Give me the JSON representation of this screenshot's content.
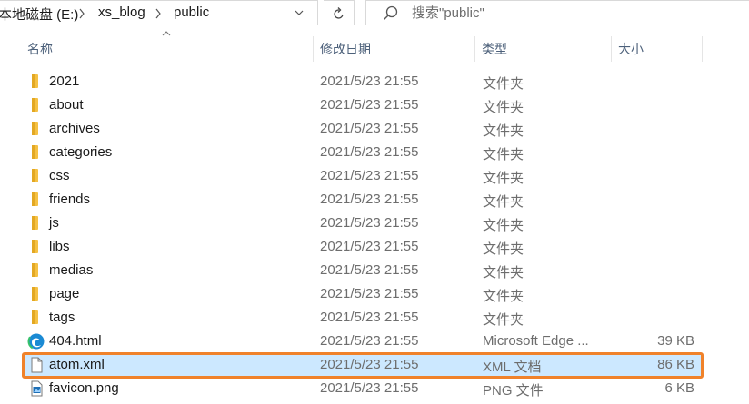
{
  "breadcrumb": {
    "drive": "本地磁盘 (E:)",
    "folder1": "xs_blog",
    "folder2": "public"
  },
  "search": {
    "placeholder": "搜索\"public\""
  },
  "columns": {
    "name": "名称",
    "date": "修改日期",
    "type": "类型",
    "size": "大小"
  },
  "files": [
    {
      "name": "2021",
      "date": "2021/5/23 21:55",
      "type": "文件夹",
      "size": "",
      "kind": "folder-icon"
    },
    {
      "name": "about",
      "date": "2021/5/23 21:55",
      "type": "文件夹",
      "size": "",
      "kind": "folder-icon"
    },
    {
      "name": "archives",
      "date": "2021/5/23 21:55",
      "type": "文件夹",
      "size": "",
      "kind": "folder-icon"
    },
    {
      "name": "categories",
      "date": "2021/5/23 21:55",
      "type": "文件夹",
      "size": "",
      "kind": "folder-icon"
    },
    {
      "name": "css",
      "date": "2021/5/23 21:55",
      "type": "文件夹",
      "size": "",
      "kind": "folder-icon"
    },
    {
      "name": "friends",
      "date": "2021/5/23 21:55",
      "type": "文件夹",
      "size": "",
      "kind": "folder-icon"
    },
    {
      "name": "js",
      "date": "2021/5/23 21:55",
      "type": "文件夹",
      "size": "",
      "kind": "folder-icon"
    },
    {
      "name": "libs",
      "date": "2021/5/23 21:55",
      "type": "文件夹",
      "size": "",
      "kind": "folder-icon"
    },
    {
      "name": "medias",
      "date": "2021/5/23 21:55",
      "type": "文件夹",
      "size": "",
      "kind": "folder-icon"
    },
    {
      "name": "page",
      "date": "2021/5/23 21:55",
      "type": "文件夹",
      "size": "",
      "kind": "folder-icon"
    },
    {
      "name": "tags",
      "date": "2021/5/23 21:55",
      "type": "文件夹",
      "size": "",
      "kind": "folder-icon"
    },
    {
      "name": "404.html",
      "date": "2021/5/23 21:55",
      "type": "Microsoft Edge ...",
      "size": "39 KB",
      "kind": "edge-html-icon"
    },
    {
      "name": "atom.xml",
      "date": "2021/5/23 21:55",
      "type": "XML 文档",
      "size": "86 KB",
      "kind": "document-icon",
      "selected": true
    },
    {
      "name": "favicon.png",
      "date": "2021/5/23 21:55",
      "type": "PNG 文件",
      "size": "6 KB",
      "kind": "image-file-icon"
    }
  ],
  "colors": {
    "selection": "#cce8ff",
    "highlight_border": "#f0822a",
    "folder": "#f5c144",
    "header_text": "#4c607a"
  }
}
